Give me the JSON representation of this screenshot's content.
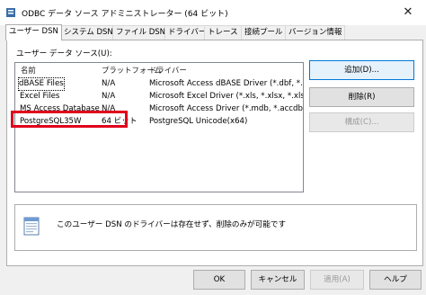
{
  "window": {
    "title": "ODBC データ ソース アドミニストレーター (64 ビット)",
    "close_glyph": "✕"
  },
  "tabs": [
    {
      "label": "ユーザー DSN",
      "active": true
    },
    {
      "label": "システム DSN"
    },
    {
      "label": "ファイル DSN"
    },
    {
      "label": "ドライバー"
    },
    {
      "label": "トレース"
    },
    {
      "label": "接続プール"
    },
    {
      "label": "バージョン情報"
    }
  ],
  "user_dsn": {
    "section_label": "ユーザー データ ソース(U):",
    "columns": [
      "名前",
      "プラットフォーム",
      "ドライバー"
    ],
    "rows": [
      {
        "name": "dBASE Files",
        "platform": "N/A",
        "driver": "Microsoft Access dBASE Driver (*.dbf, *.nd"
      },
      {
        "name": "Excel Files",
        "platform": "N/A",
        "driver": "Microsoft Excel Driver (*.xls, *.xlsx, *.xlsm"
      },
      {
        "name": "MS Access Database",
        "platform": "N/A",
        "driver": "Microsoft Access Driver (*.mdb, *.accdb)"
      },
      {
        "name": "PostgreSQL35W",
        "platform": "64 ビット",
        "driver": "PostgreSQL Unicode(x64)"
      }
    ],
    "buttons": {
      "add": "追加(D)...",
      "remove": "削除(R)",
      "configure": "構成(C)..."
    },
    "info_text": "このユーザー DSN のドライバーは存在せず、削除のみが可能です"
  },
  "footer": {
    "ok": "OK",
    "cancel": "キャンセル",
    "apply": "適用(A)",
    "help": "ヘルプ"
  },
  "colors": {
    "highlight": "#e0001b",
    "primary_border": "#0078d7"
  },
  "icons": {
    "app": "odbc-app-icon",
    "info": "data-source-icon",
    "close": "close-icon"
  }
}
